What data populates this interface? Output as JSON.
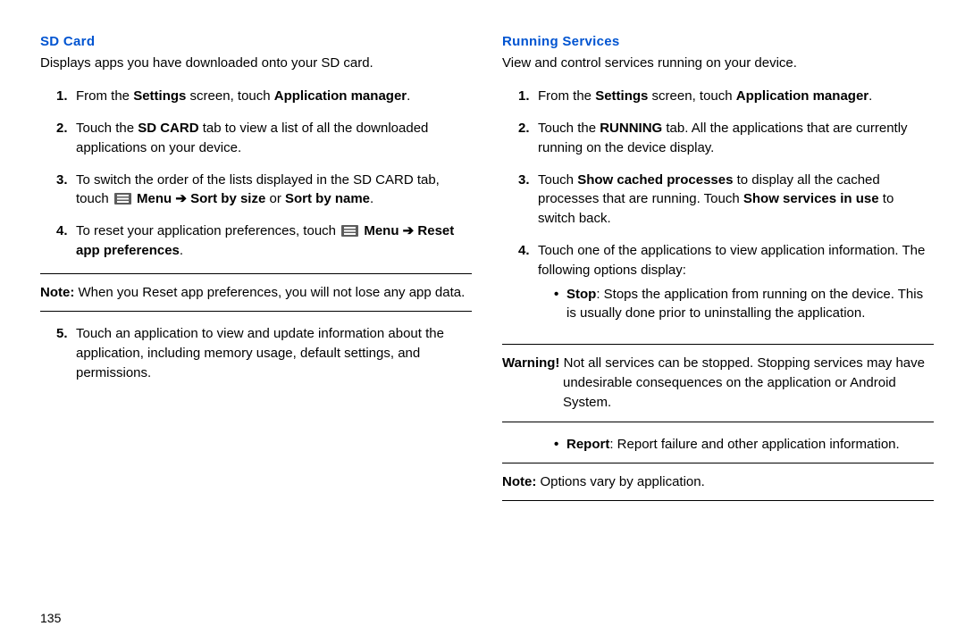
{
  "left": {
    "heading": "SD Card",
    "intro": "Displays apps you have downloaded onto your SD card.",
    "step1_a": "From the ",
    "step1_b": "Settings",
    "step1_c": " screen, touch ",
    "step1_d": "Application manager",
    "step1_e": ".",
    "step2_a": "Touch the ",
    "step2_b": "SD CARD",
    "step2_c": " tab to view a list of all the downloaded applications on your device.",
    "step3_a": "To switch the order of the lists displayed in the SD CARD tab, touch ",
    "step3_b": "Menu ➔ Sort by size",
    "step3_c": " or ",
    "step3_d": "Sort by name",
    "step3_e": ".",
    "step4_a": "To reset your application preferences, touch ",
    "step4_b": "Menu ➔ Reset app preferences",
    "step4_c": ".",
    "note_label": "Note:",
    "note_body": " When you Reset app preferences, you will not lose any app data.",
    "step5": "Touch an application to view and update information about the application, including memory usage, default settings, and permissions."
  },
  "right": {
    "heading": "Running Services",
    "intro": "View and control services running on your device.",
    "step1_a": "From the ",
    "step1_b": "Settings",
    "step1_c": " screen, touch ",
    "step1_d": "Application manager",
    "step1_e": ".",
    "step2_a": "Touch the ",
    "step2_b": "RUNNING",
    "step2_c": " tab. All the applications that are currently running on the device display.",
    "step3_a": "Touch ",
    "step3_b": "Show cached processes",
    "step3_c": " to display all the cached processes that are running. Touch ",
    "step3_d": "Show services in use",
    "step3_e": " to switch back.",
    "step4": "Touch one of the applications to view application information. The following options display:",
    "bullet_stop_a": "Stop",
    "bullet_stop_b": ": Stops the application from running on the device. This is usually done prior to uninstalling the application.",
    "warn_label": "Warning!",
    "warn_body": " Not all services can be stopped. Stopping services may have undesirable consequences on the application or Android System.",
    "bullet_report_a": "Report",
    "bullet_report_b": ": Report failure and other application information.",
    "note_label": "Note:",
    "note_body": " Options vary by application."
  },
  "page_number": "135"
}
